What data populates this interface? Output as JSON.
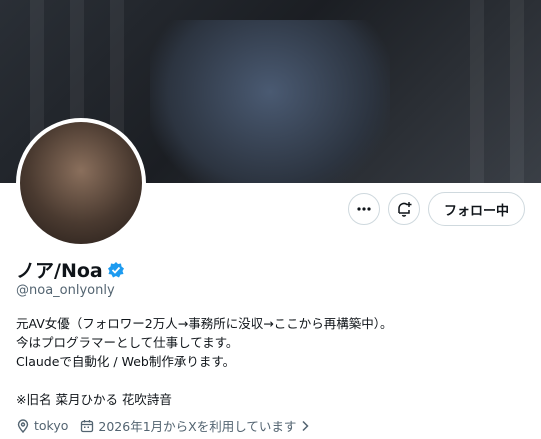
{
  "profile": {
    "display_name": "ノア/Noa",
    "handle": "@noa_onlyonly",
    "verified_badge_icon": "verified-check-icon",
    "bio_lines": [
      "元AV女優（フォロワー2万人→事務所に没収→ここから再構築中）。",
      "今はプログラマーとして仕事してます。",
      "Claudeで自動化 / Web制作承ります。",
      "",
      "※旧名 菜月ひかる 花吹詩音"
    ],
    "location": "tokyo",
    "joined": "2026年1月からXを利用しています"
  },
  "actions": {
    "more_icon": "more-icon",
    "notify_icon": "bell-plus-icon",
    "follow_label": "フォロー中"
  },
  "colors": {
    "verified": "#1d9bf0",
    "secondary_text": "#536471",
    "border": "#cfd9de"
  }
}
